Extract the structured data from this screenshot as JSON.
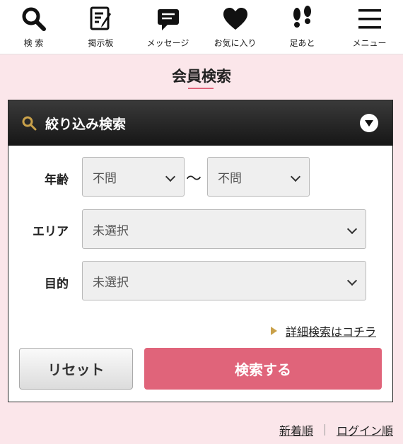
{
  "nav": [
    {
      "label": "検 索",
      "icon": "search-icon"
    },
    {
      "label": "掲示板",
      "icon": "board-icon"
    },
    {
      "label": "メッセージ",
      "icon": "message-icon"
    },
    {
      "label": "お気に入り",
      "icon": "heart-icon"
    },
    {
      "label": "足あと",
      "icon": "footprint-icon"
    },
    {
      "label": "メニュー",
      "icon": "menu-icon"
    }
  ],
  "page": {
    "title": "会員検索"
  },
  "panel": {
    "header": "絞り込み検索",
    "age": {
      "label": "年齢",
      "from": "不問",
      "to": "不問",
      "separator": "〜"
    },
    "area": {
      "label": "エリア",
      "value": "未選択"
    },
    "purpose": {
      "label": "目的",
      "value": "未選択"
    },
    "detail_link": "詳細検索はコチラ",
    "reset": "リセット",
    "search": "検索する"
  },
  "sort": {
    "newest": "新着順",
    "login": "ログイン順"
  },
  "colors": {
    "accent": "#e0647a",
    "background": "#fbe6ea",
    "header": "#1e1e1e",
    "search_icon": "#c9a14a"
  }
}
